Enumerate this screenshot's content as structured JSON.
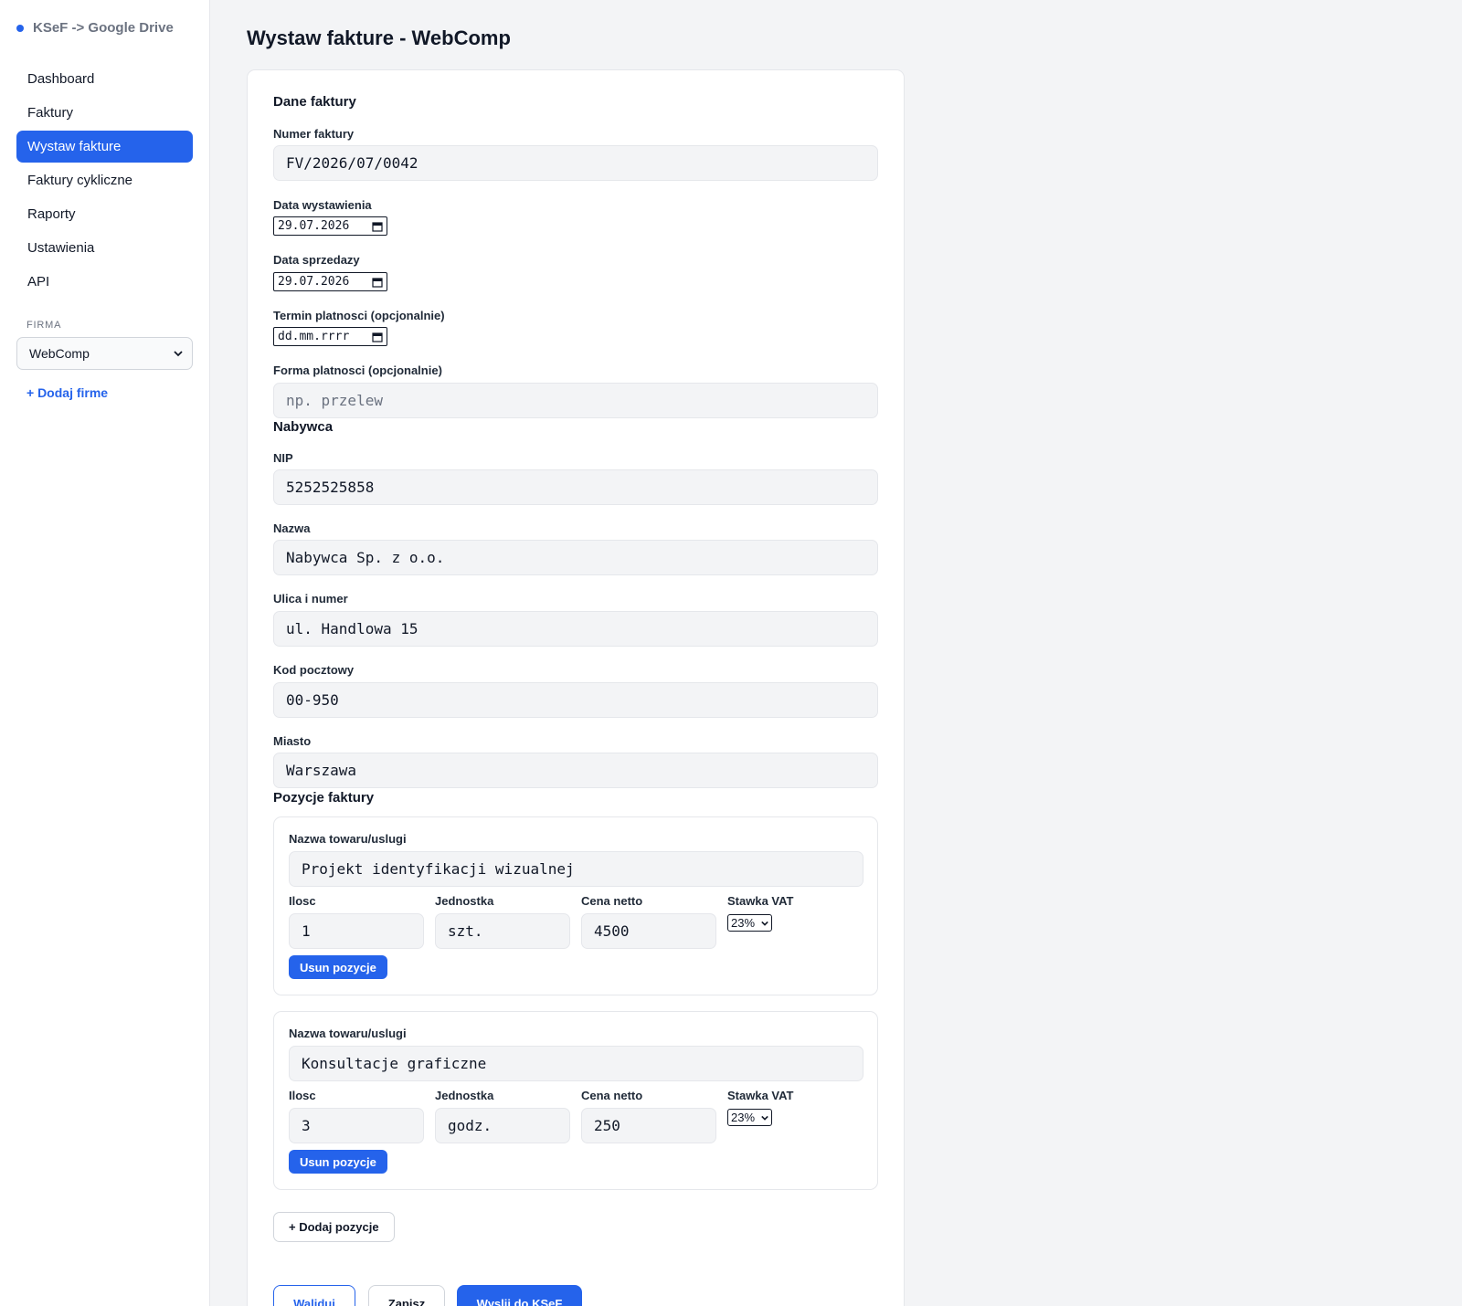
{
  "app": {
    "brand": "KSeF -> Google Drive"
  },
  "sidebar": {
    "items": [
      {
        "label": "Dashboard"
      },
      {
        "label": "Faktury"
      },
      {
        "label": "Wystaw fakture"
      },
      {
        "label": "Faktury cykliczne"
      },
      {
        "label": "Raporty"
      },
      {
        "label": "Ustawienia"
      },
      {
        "label": "API"
      }
    ],
    "active_item": "Wystaw fakture",
    "firm_label": "FIRMA",
    "firm_selected": "WebComp",
    "add_firm": "+ Dodaj firme"
  },
  "page": {
    "title": "Wystaw fakture - WebComp"
  },
  "invoice": {
    "section_title": "Dane faktury",
    "number_label": "Numer faktury",
    "number_value": "FV/2026/07/0042",
    "issue_date_label": "Data wystawienia",
    "issue_date_value": "29.07.2026",
    "sale_date_label": "Data sprzedazy",
    "sale_date_value": "29.07.2026",
    "due_date_label": "Termin platnosci (opcjonalnie)",
    "due_date_placeholder": "dd.mm.rrrr",
    "payment_label": "Forma platnosci (opcjonalnie)",
    "payment_placeholder": "np. przelew"
  },
  "buyer": {
    "section_title": "Nabywca",
    "nip_label": "NIP",
    "nip_value": "5252525858",
    "name_label": "Nazwa",
    "name_value": "Nabywca Sp. z o.o.",
    "street_label": "Ulica i numer",
    "street_value": "ul. Handlowa 15",
    "postal_label": "Kod pocztowy",
    "postal_value": "00-950",
    "city_label": "Miasto",
    "city_value": "Warszawa"
  },
  "items": {
    "section_title": "Pozycje faktury",
    "name_label": "Nazwa towaru/uslugi",
    "qty_label": "Ilosc",
    "unit_label": "Jednostka",
    "price_label": "Cena netto",
    "vat_label": "Stawka VAT",
    "remove_label": "Usun pozycje",
    "add_label": "+ Dodaj pozycje",
    "list": [
      {
        "name": "Projekt identyfikacji wizualnej",
        "qty": "1",
        "unit": "szt.",
        "price": "4500",
        "vat": "23%"
      },
      {
        "name": "Konsultacje graficzne",
        "qty": "3",
        "unit": "godz.",
        "price": "250",
        "vat": "23%"
      }
    ]
  },
  "actions": {
    "validate": "Waliduj",
    "save": "Zapisz",
    "send": "Wyslij do KSeF"
  },
  "colors": {
    "accent": "#2563eb",
    "sidebar_bg": "#ffffff",
    "page_bg": "#f3f4f6"
  }
}
